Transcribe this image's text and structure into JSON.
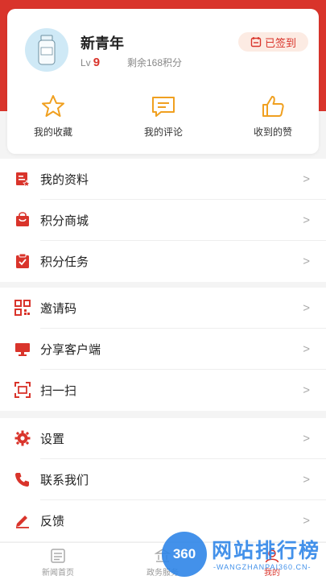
{
  "profile": {
    "username": "新青年",
    "level_prefix": "Lv",
    "level_value": "9",
    "points_text": "剩余168积分",
    "signin_label": "已签到"
  },
  "quick_actions": [
    {
      "label": "我的收藏",
      "icon": "star-icon"
    },
    {
      "label": "我的评论",
      "icon": "comment-icon"
    },
    {
      "label": "收到的赞",
      "icon": "thumbs-up-icon"
    }
  ],
  "menu_group_1": [
    {
      "label": "我的资料",
      "icon": "profile-card-icon"
    },
    {
      "label": "积分商城",
      "icon": "shopping-bag-icon"
    },
    {
      "label": "积分任务",
      "icon": "task-clipboard-icon"
    }
  ],
  "menu_group_2": [
    {
      "label": "邀请码",
      "icon": "qr-code-icon"
    },
    {
      "label": "分享客户端",
      "icon": "monitor-icon"
    },
    {
      "label": "扫一扫",
      "icon": "scan-icon"
    }
  ],
  "menu_group_3": [
    {
      "label": "设置",
      "icon": "gear-icon"
    },
    {
      "label": "联系我们",
      "icon": "phone-icon"
    },
    {
      "label": "反馈",
      "icon": "pencil-icon"
    }
  ],
  "chevron": ">",
  "tabbar": [
    {
      "label": "新闻首页",
      "icon": "news-icon"
    },
    {
      "label": "政务服务",
      "icon": "government-icon"
    },
    {
      "label": "我的",
      "icon": "user-icon"
    }
  ],
  "watermark": {
    "badge": "360",
    "title": "网站排行榜",
    "subtitle": "-WANGZHANPAI360.CN-"
  },
  "colors": {
    "accent": "#d9342b",
    "quick_icon": "#f0a020",
    "watermark": "#2f86e8"
  }
}
